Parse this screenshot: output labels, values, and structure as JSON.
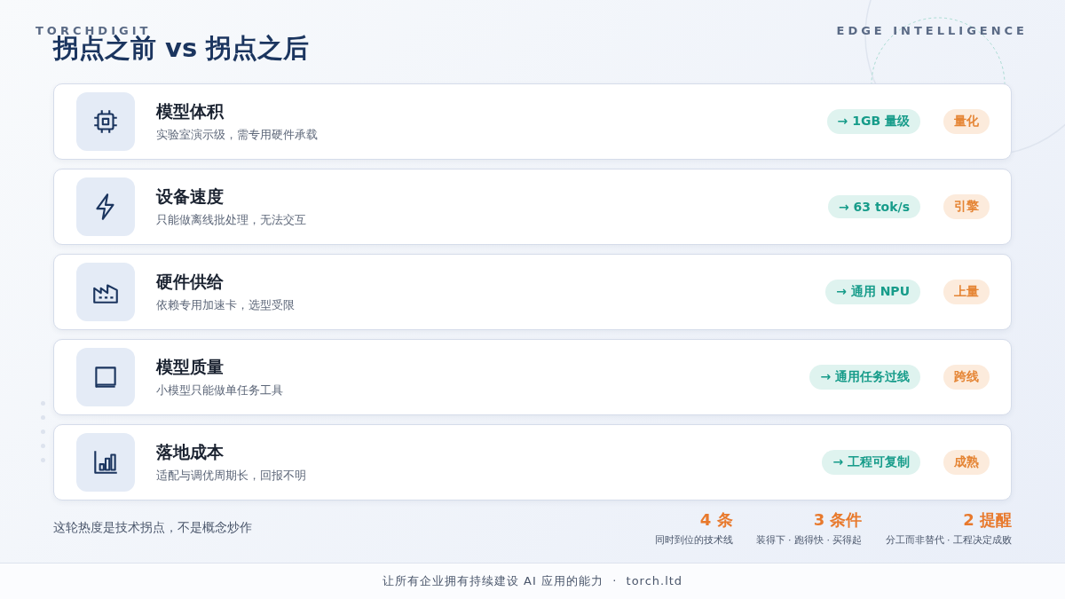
{
  "brand": "TORCHDIGIT",
  "tagline": "EDGE INTELLIGENCE",
  "title": "拐点之前 vs 拐点之后",
  "items": [
    {
      "title": "模型体积",
      "desc": "实验室演示级，需专用硬件承载",
      "after": "→ 1GB 量级",
      "tag": "量化"
    },
    {
      "title": "设备速度",
      "desc": "只能做离线批处理，无法交互",
      "after": "→ 63 tok/s",
      "tag": "引擎"
    },
    {
      "title": "硬件供给",
      "desc": "依赖专用加速卡，选型受限",
      "after": "→ 通用 NPU",
      "tag": "上量"
    },
    {
      "title": "模型质量",
      "desc": "小模型只能做单任务工具",
      "after": "→ 通用任务过线",
      "tag": "跨线"
    },
    {
      "title": "落地成本",
      "desc": "适配与调优周期长，回报不明",
      "after": "→ 工程可复制",
      "tag": "成熟"
    }
  ],
  "summary": "这轮热度是技术拐点，不是概念炒作",
  "stats": [
    {
      "value": "4 条",
      "label": "同时到位的技术线"
    },
    {
      "value": "3 条件",
      "label": "装得下 · 跑得快 · 买得起"
    },
    {
      "value": "2 提醒",
      "label": "分工而非替代 · 工程决定成败"
    }
  ],
  "footer": "让所有企业拥有持续建设 AI 应用的能力  ·  torch.ltd"
}
